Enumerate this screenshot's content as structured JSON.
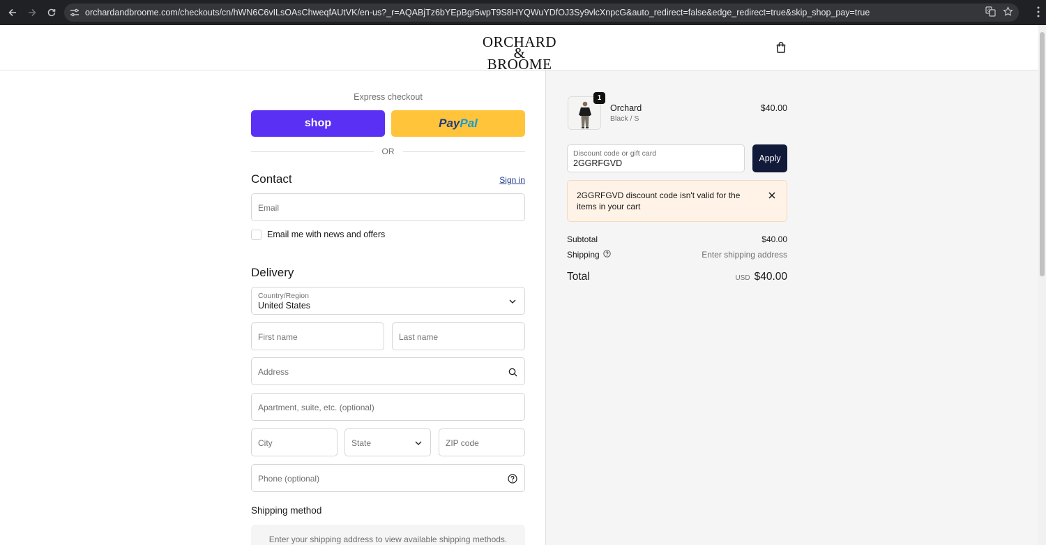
{
  "browser": {
    "url": "orchardandbroome.com/checkouts/cn/hWN6C6vILsOAsChweqfAUtVK/en-us?_r=AQABjTz6bYEpBgr5wpT9S8HYQWuYDfOJ3Sy9vlcXnpcG&auto_redirect=false&edge_redirect=true&skip_shop_pay=true",
    "icons": [
      "back-icon",
      "forward-icon",
      "reload-icon",
      "site-settings-icon",
      "translate-icon",
      "bookmark-star-icon",
      "menu-kebab-icon"
    ]
  },
  "header": {
    "logo_line1": "ORCHARD",
    "logo_line2": "& BROOME",
    "cart_icon": "shopping-bag-icon"
  },
  "checkout": {
    "express_label": "Express checkout",
    "shop_label": "shop",
    "paypal_pay": "Pay",
    "paypal_pal": "Pal",
    "or_label": "OR",
    "contact_title": "Contact",
    "sign_in": "Sign in",
    "email_placeholder": "Email",
    "newsletter_label": "Email me with news and offers",
    "delivery_title": "Delivery",
    "country_label": "Country/Region",
    "country_value": "United States",
    "first_name_placeholder": "First name",
    "last_name_placeholder": "Last name",
    "address_placeholder": "Address",
    "apartment_placeholder": "Apartment, suite, etc. (optional)",
    "city_placeholder": "City",
    "state_placeholder": "State",
    "zip_placeholder": "ZIP code",
    "phone_placeholder": "Phone (optional)",
    "shipping_method_title": "Shipping method",
    "shipping_method_note": "Enter your shipping address to view available shipping methods."
  },
  "summary": {
    "item": {
      "quantity": "1",
      "name": "Orchard",
      "variant": "Black / S",
      "price": "$40.00"
    },
    "discount_label": "Discount code or gift card",
    "discount_value": "2GGRFGVD",
    "apply_label": "Apply",
    "error_message": "2GGRFGVD discount code isn't valid for the items in your cart",
    "subtotal_label": "Subtotal",
    "subtotal_value": "$40.00",
    "shipping_label": "Shipping",
    "shipping_value": "Enter shipping address",
    "total_label": "Total",
    "currency": "USD",
    "total_value": "$40.00"
  },
  "colors": {
    "shop_pay": "#5a31f4",
    "paypal": "#ffc439",
    "apply_button": "#121a3a",
    "alert_background": "#fff3e7"
  }
}
